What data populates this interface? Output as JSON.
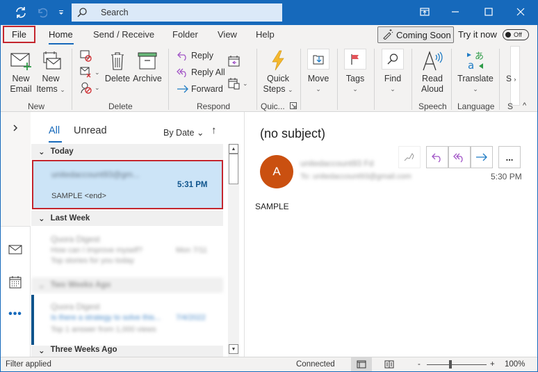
{
  "titlebar": {
    "search_placeholder": "Search",
    "icons": [
      "sync-icon",
      "undo-icon",
      "quick-access-dropdown-icon",
      "search-icon",
      "ribbon-display-icon",
      "minimize-icon",
      "maximize-icon",
      "close-icon"
    ]
  },
  "tabs": {
    "file": "File",
    "items": [
      "Home",
      "Send / Receive",
      "Folder",
      "View",
      "Help"
    ],
    "active": "Home",
    "coming_soon": "Coming Soon",
    "try_now": "Try it now",
    "toggle_state": "Off"
  },
  "ribbon": {
    "groups": {
      "new": "New",
      "delete": "Delete",
      "respond": "Respond",
      "quick_steps": "Quic...",
      "speech": "Speech",
      "language": "Language",
      "overflow": "S"
    },
    "new_email": [
      "New",
      "Email"
    ],
    "new_items": [
      "New",
      "Items"
    ],
    "delete": "Delete",
    "archive": "Archive",
    "reply": "Reply",
    "reply_all": "Reply All",
    "forward": "Forward",
    "quick_steps": [
      "Quick",
      "Steps"
    ],
    "move": "Move",
    "tags": "Tags",
    "find": "Find",
    "read_aloud": [
      "Read",
      "Aloud"
    ],
    "translate": "Translate",
    "overflow_label": "S"
  },
  "message_list": {
    "filters": [
      "All",
      "Unread"
    ],
    "active_filter": "All",
    "sort": "By Date",
    "groups": [
      "Today",
      "Last Week",
      "Two Weeks Ago",
      "Three Weeks Ago"
    ],
    "selected_message": {
      "sender": "[blurred email address]",
      "time": "5:31 PM",
      "preview": "SAMPLE <end>"
    },
    "other_messages": [
      {
        "sender": "[blurred]",
        "subject": "[blurred]",
        "time": "[blurred]",
        "preview": "[blurred]"
      },
      {
        "sender": "[blurred]",
        "subject": "[blurred]",
        "time": "[blurred]",
        "preview": "[blurred]"
      }
    ]
  },
  "reading_pane": {
    "subject": "(no subject)",
    "avatar_initial": "A",
    "avatar_color": "#ca5010",
    "from": "[blurred]",
    "to": "[blurred]",
    "time": "5:30 PM",
    "body": "SAMPLE",
    "more_label": "..."
  },
  "statusbar": {
    "left": "Filter applied",
    "connection": "Connected",
    "zoom_minus": "-",
    "zoom_plus": "+",
    "zoom_level": "100%",
    "zoom_fraction": 0.4
  },
  "colors": {
    "accent": "#1669bb",
    "highlight_box": "#c4262e",
    "selection": "#cce4f7"
  }
}
